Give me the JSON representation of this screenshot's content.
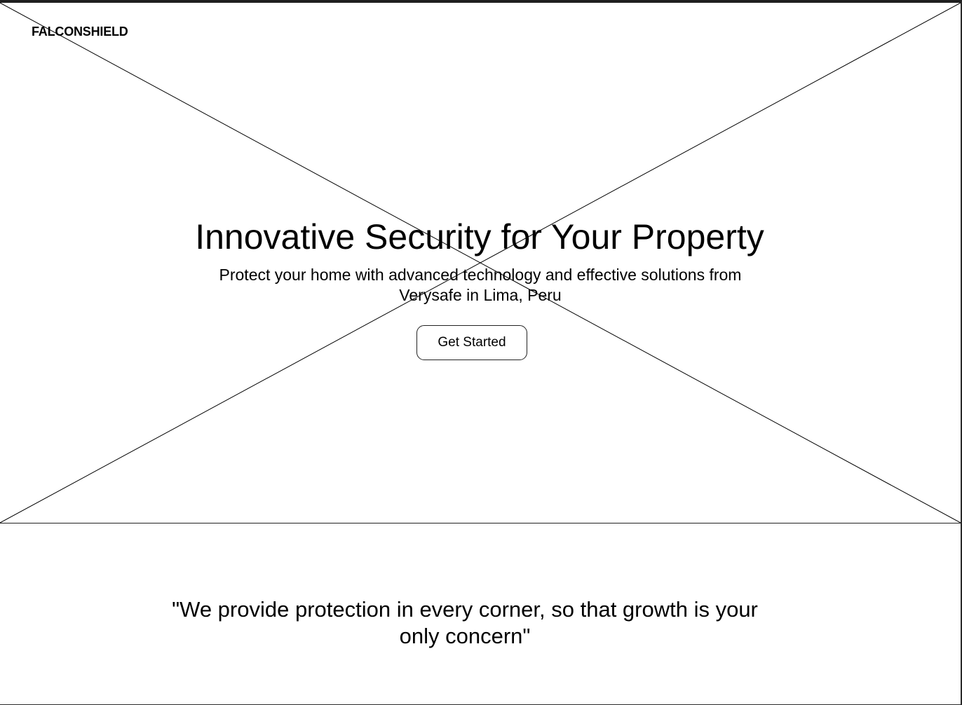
{
  "brand": {
    "logo_text": "FALCONSHIELD"
  },
  "hero": {
    "title": "Innovative Security for Your Property",
    "subtitle": "Protect your home with advanced technology and effective solutions from Verysafe in Lima, Peru",
    "cta_label": "Get Started",
    "image_placeholder_icon": "image-placeholder-icon"
  },
  "quote": {
    "text": "\"We provide protection in every corner, so that growth is your only concern\""
  },
  "colors": {
    "background": "#ffffff",
    "line": "#000000",
    "top_bar": "#1f1f1f"
  }
}
